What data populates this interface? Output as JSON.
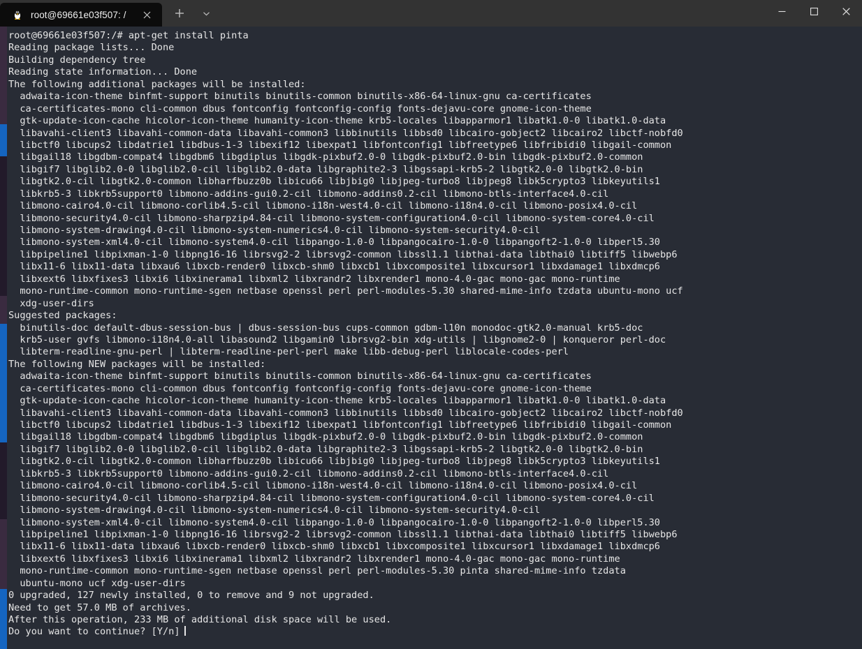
{
  "window": {
    "tab": {
      "title": "root@69661e03f507: /",
      "icon": "linux-penguin-icon",
      "close_icon": "close-icon"
    },
    "new_tab_icon": "plus-icon",
    "tab_menu_icon": "chevron-down-icon",
    "controls": {
      "minimize": "minimize-icon",
      "maximize": "maximize-icon",
      "close": "close-icon"
    },
    "colors": {
      "titlebar": "#333333",
      "active_tab": "#0c0c0c",
      "terminal_background": "#282c35",
      "terminal_foreground": "#e6e6e6"
    }
  },
  "terminal": {
    "prompt": "root@69661e03f507:/#",
    "command": "apt-get install pinta",
    "cursor": "block-cursor",
    "lines": [
      "root@69661e03f507:/# apt-get install pinta",
      "Reading package lists... Done",
      "Building dependency tree",
      "Reading state information... Done",
      "The following additional packages will be installed:",
      "  adwaita-icon-theme binfmt-support binutils binutils-common binutils-x86-64-linux-gnu ca-certificates",
      "  ca-certificates-mono cli-common dbus fontconfig fontconfig-config fonts-dejavu-core gnome-icon-theme",
      "  gtk-update-icon-cache hicolor-icon-theme humanity-icon-theme krb5-locales libapparmor1 libatk1.0-0 libatk1.0-data",
      "  libavahi-client3 libavahi-common-data libavahi-common3 libbinutils libbsd0 libcairo-gobject2 libcairo2 libctf-nobfd0",
      "  libctf0 libcups2 libdatrie1 libdbus-1-3 libexif12 libexpat1 libfontconfig1 libfreetype6 libfribidi0 libgail-common",
      "  libgail18 libgdbm-compat4 libgdbm6 libgdiplus libgdk-pixbuf2.0-0 libgdk-pixbuf2.0-bin libgdk-pixbuf2.0-common",
      "  libgif7 libglib2.0-0 libglib2.0-cil libglib2.0-data libgraphite2-3 libgssapi-krb5-2 libgtk2.0-0 libgtk2.0-bin",
      "  libgtk2.0-cil libgtk2.0-common libharfbuzz0b libicu66 libjbig0 libjpeg-turbo8 libjpeg8 libk5crypto3 libkeyutils1",
      "  libkrb5-3 libkrb5support0 libmono-addins-gui0.2-cil libmono-addins0.2-cil libmono-btls-interface4.0-cil",
      "  libmono-cairo4.0-cil libmono-corlib4.5-cil libmono-i18n-west4.0-cil libmono-i18n4.0-cil libmono-posix4.0-cil",
      "  libmono-security4.0-cil libmono-sharpzip4.84-cil libmono-system-configuration4.0-cil libmono-system-core4.0-cil",
      "  libmono-system-drawing4.0-cil libmono-system-numerics4.0-cil libmono-system-security4.0-cil",
      "  libmono-system-xml4.0-cil libmono-system4.0-cil libpango-1.0-0 libpangocairo-1.0-0 libpangoft2-1.0-0 libperl5.30",
      "  libpipeline1 libpixman-1-0 libpng16-16 librsvg2-2 librsvg2-common libssl1.1 libthai-data libthai0 libtiff5 libwebp6",
      "  libx11-6 libx11-data libxau6 libxcb-render0 libxcb-shm0 libxcb1 libxcomposite1 libxcursor1 libxdamage1 libxdmcp6",
      "  libxext6 libxfixes3 libxi6 libxinerama1 libxml2 libxrandr2 libxrender1 mono-4.0-gac mono-gac mono-runtime",
      "  mono-runtime-common mono-runtime-sgen netbase openssl perl perl-modules-5.30 shared-mime-info tzdata ubuntu-mono ucf",
      "  xdg-user-dirs",
      "Suggested packages:",
      "  binutils-doc default-dbus-session-bus | dbus-session-bus cups-common gdbm-l10n monodoc-gtk2.0-manual krb5-doc",
      "  krb5-user gvfs libmono-i18n4.0-all libasound2 libgamin0 librsvg2-bin xdg-utils | libgnome2-0 | konqueror perl-doc",
      "  libterm-readline-gnu-perl | libterm-readline-perl-perl make libb-debug-perl liblocale-codes-perl",
      "The following NEW packages will be installed:",
      "  adwaita-icon-theme binfmt-support binutils binutils-common binutils-x86-64-linux-gnu ca-certificates",
      "  ca-certificates-mono cli-common dbus fontconfig fontconfig-config fonts-dejavu-core gnome-icon-theme",
      "  gtk-update-icon-cache hicolor-icon-theme humanity-icon-theme krb5-locales libapparmor1 libatk1.0-0 libatk1.0-data",
      "  libavahi-client3 libavahi-common-data libavahi-common3 libbinutils libbsd0 libcairo-gobject2 libcairo2 libctf-nobfd0",
      "  libctf0 libcups2 libdatrie1 libdbus-1-3 libexif12 libexpat1 libfontconfig1 libfreetype6 libfribidi0 libgail-common",
      "  libgail18 libgdbm-compat4 libgdbm6 libgdiplus libgdk-pixbuf2.0-0 libgdk-pixbuf2.0-bin libgdk-pixbuf2.0-common",
      "  libgif7 libglib2.0-0 libglib2.0-cil libglib2.0-data libgraphite2-3 libgssapi-krb5-2 libgtk2.0-0 libgtk2.0-bin",
      "  libgtk2.0-cil libgtk2.0-common libharfbuzz0b libicu66 libjbig0 libjpeg-turbo8 libjpeg8 libk5crypto3 libkeyutils1",
      "  libkrb5-3 libkrb5support0 libmono-addins-gui0.2-cil libmono-addins0.2-cil libmono-btls-interface4.0-cil",
      "  libmono-cairo4.0-cil libmono-corlib4.5-cil libmono-i18n-west4.0-cil libmono-i18n4.0-cil libmono-posix4.0-cil",
      "  libmono-security4.0-cil libmono-sharpzip4.84-cil libmono-system-configuration4.0-cil libmono-system-core4.0-cil",
      "  libmono-system-drawing4.0-cil libmono-system-numerics4.0-cil libmono-system-security4.0-cil",
      "  libmono-system-xml4.0-cil libmono-system4.0-cil libpango-1.0-0 libpangocairo-1.0-0 libpangoft2-1.0-0 libperl5.30",
      "  libpipeline1 libpixman-1-0 libpng16-16 librsvg2-2 librsvg2-common libssl1.1 libthai-data libthai0 libtiff5 libwebp6",
      "  libx11-6 libx11-data libxau6 libxcb-render0 libxcb-shm0 libxcb1 libxcomposite1 libxcursor1 libxdamage1 libxdmcp6",
      "  libxext6 libxfixes3 libxi6 libxinerama1 libxml2 libxrandr2 libxrender1 mono-4.0-gac mono-gac mono-runtime",
      "  mono-runtime-common mono-runtime-sgen netbase openssl perl perl-modules-5.30 pinta shared-mime-info tzdata",
      "  ubuntu-mono ucf xdg-user-dirs",
      "0 upgraded, 127 newly installed, 0 to remove and 9 not upgraded.",
      "Need to get 57.0 MB of archives.",
      "After this operation, 233 MB of additional disk space will be used.",
      "Do you want to continue? [Y/n]"
    ],
    "summary": {
      "upgraded": "0",
      "newly_installed": "127",
      "to_remove": "0",
      "not_upgraded": "9",
      "archive_size": "57.0 MB",
      "disk_space": "233 MB",
      "prompt_question": "Do you want to continue? [Y/n]"
    }
  }
}
